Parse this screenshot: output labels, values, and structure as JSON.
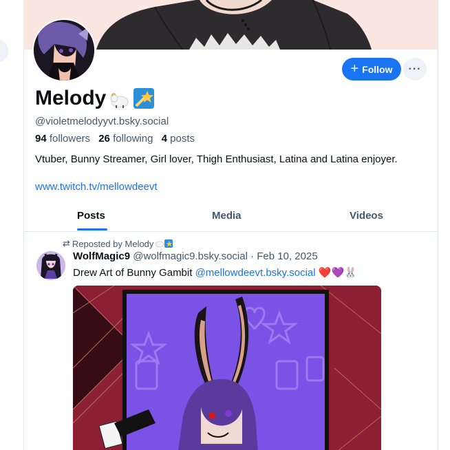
{
  "profile": {
    "display_name": "Melody",
    "handle": "@violetmelodyyvt.bsky.social",
    "followers_count": "94",
    "followers_label": "followers",
    "following_count": "26",
    "following_label": "following",
    "posts_count": "4",
    "posts_label": "posts",
    "bio": "Vtuber, Bunny Streamer, Girl lover, Thigh Enthusiast, Latina and Latina enjoyer.",
    "link": "www.twitch.tv/mellowdeevt"
  },
  "actions": {
    "follow_label": "Follow",
    "more_label": "···"
  },
  "tabs": [
    {
      "label": "Posts",
      "active": true
    },
    {
      "label": "Media",
      "active": false
    },
    {
      "label": "Videos",
      "active": false
    }
  ],
  "post": {
    "repost_label": "Reposted by Melody",
    "author_name": "WolfMagic9",
    "author_handle": "@wolfmagic9.bsky.social",
    "separator": " · ",
    "date": "Feb 10, 2025",
    "text_prefix": "Drew Art of Bunny Gambit ",
    "mention": "@mellowdeevt.bsky.social",
    "emoji_suffix": " ❤️💜🐰"
  },
  "colors": {
    "accent": "#1a73f0",
    "banner_bg": "#fbe6e2",
    "image_bg": "#8d1f34",
    "image_card": "#7b52e6"
  },
  "icons": {
    "repost": "repost-icon",
    "plus": "plus-icon",
    "more": "ellipsis-icon"
  }
}
